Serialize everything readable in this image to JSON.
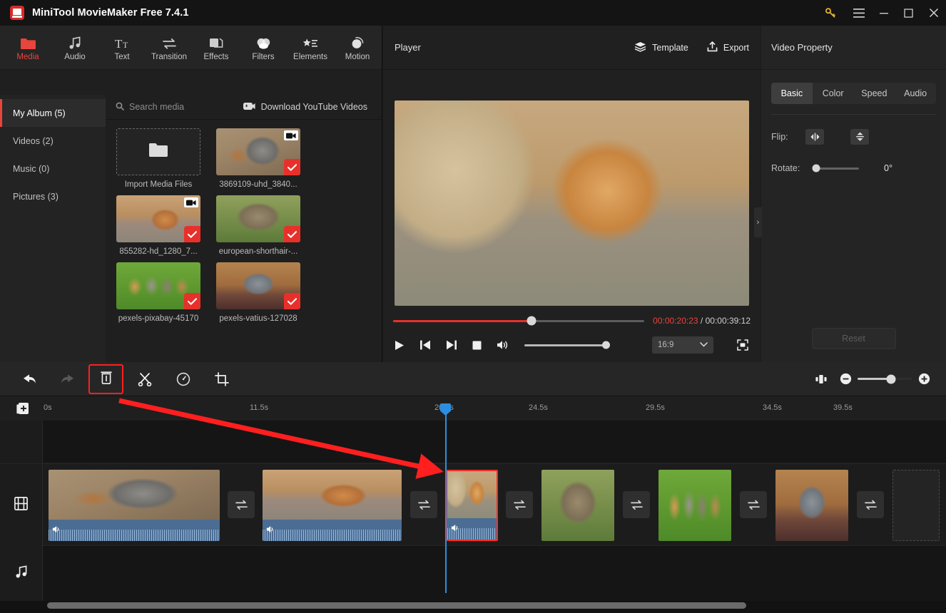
{
  "window": {
    "title": "MiniTool MovieMaker Free 7.4.1",
    "controls": [
      "key-icon",
      "menu-icon",
      "minimize-icon",
      "maximize-icon",
      "close-icon"
    ],
    "accent": "#e8453c",
    "playhead_color": "#2a8fe0",
    "annotation_color": "#ff1f1f"
  },
  "ribbon": {
    "items": [
      {
        "label": "Media",
        "icon": "folder-icon",
        "active": true
      },
      {
        "label": "Audio",
        "icon": "music-note-icon",
        "active": false
      },
      {
        "label": "Text",
        "icon": "text-icon",
        "active": false
      },
      {
        "label": "Transition",
        "icon": "transition-icon",
        "active": false
      },
      {
        "label": "Effects",
        "icon": "effects-icon",
        "active": false
      },
      {
        "label": "Filters",
        "icon": "filters-icon",
        "active": false
      },
      {
        "label": "Elements",
        "icon": "elements-icon",
        "active": false
      },
      {
        "label": "Motion",
        "icon": "motion-icon",
        "active": false
      }
    ]
  },
  "library": {
    "categories": [
      {
        "label": "My Album (5)",
        "active": true
      },
      {
        "label": "Videos (2)",
        "active": false
      },
      {
        "label": "Music (0)",
        "active": false
      },
      {
        "label": "Pictures (3)",
        "active": false
      }
    ],
    "search_placeholder": "Search media",
    "download_label": "Download YouTube Videos",
    "import_label": "Import Media Files",
    "items": [
      {
        "name": "3869109-uhd_3840...",
        "is_video": true,
        "checked": true,
        "art": "ph-graycat"
      },
      {
        "name": "855282-hd_1280_7...",
        "is_video": true,
        "checked": true,
        "art": "ph-kitten"
      },
      {
        "name": "european-shorthair-...",
        "is_video": false,
        "checked": true,
        "art": "ph-shorthair"
      },
      {
        "name": "pexels-pixabay-45170",
        "is_video": false,
        "checked": true,
        "art": "ph-pixabay"
      },
      {
        "name": "pexels-vatius-127028",
        "is_video": false,
        "checked": true,
        "art": "ph-vatius"
      }
    ]
  },
  "player": {
    "title": "Player",
    "template_label": "Template",
    "export_label": "Export",
    "current_time": "00:00:20:23",
    "separator": " / ",
    "total_time": "00:00:39:12",
    "progress_percent": 55,
    "volume_percent": 100,
    "aspect_ratio": "16:9",
    "buttons": [
      "play-icon",
      "previous-frame-icon",
      "next-frame-icon",
      "stop-icon",
      "volume-icon",
      "fullscreen-icon"
    ]
  },
  "properties": {
    "title": "Video Property",
    "tabs": [
      {
        "label": "Basic",
        "active": true
      },
      {
        "label": "Color",
        "active": false
      },
      {
        "label": "Speed",
        "active": false
      },
      {
        "label": "Audio",
        "active": false
      }
    ],
    "flip_label": "Flip:",
    "flip_buttons": [
      "flip-horizontal-icon",
      "flip-vertical-icon"
    ],
    "rotate_label": "Rotate:",
    "rotate_value": "0°",
    "rotate_percent": 0,
    "reset_label": "Reset",
    "collapse_icon": "chevron-right-icon"
  },
  "toolbar": {
    "buttons": [
      {
        "name": "undo-icon",
        "enabled": true,
        "highlighted": false
      },
      {
        "name": "redo-icon",
        "enabled": false,
        "highlighted": false
      },
      {
        "name": "delete-icon",
        "enabled": true,
        "highlighted": true
      },
      {
        "name": "split-icon",
        "enabled": true,
        "highlighted": false
      },
      {
        "name": "speed-icon",
        "enabled": true,
        "highlighted": false
      },
      {
        "name": "crop-icon",
        "enabled": true,
        "highlighted": false
      }
    ],
    "zoom_fit_icon": "zoom-fit-icon",
    "zoom_out_icon": "zoom-out-icon",
    "zoom_in_icon": "zoom-in-icon",
    "zoom_percent": 62
  },
  "timeline": {
    "add_track_icon": "add-media-icon",
    "ruler_ticks": [
      "0s",
      "11.5s",
      "20.9s",
      "24.5s",
      "29.5s",
      "34.5s",
      "39.5s"
    ],
    "playhead_time": "20.9s",
    "tracks": [
      {
        "name": "overlay-track",
        "icon": ""
      },
      {
        "name": "video-track",
        "icon": "film-icon"
      },
      {
        "name": "audio-track",
        "icon": "music-note-icon"
      }
    ],
    "clips": [
      {
        "art": "ph-graycat",
        "has_audio": true,
        "selected": false
      },
      {
        "art": "ph-kitten",
        "has_audio": true,
        "selected": false
      },
      {
        "art": "ph-stage",
        "has_audio": true,
        "selected": true
      },
      {
        "art": "ph-shorthair",
        "has_audio": false,
        "selected": false
      },
      {
        "art": "ph-pixabay",
        "has_audio": false,
        "selected": false
      },
      {
        "art": "ph-vatius",
        "has_audio": false,
        "selected": false
      }
    ],
    "transition_icon": "transition-icon",
    "transition_count": 5
  }
}
